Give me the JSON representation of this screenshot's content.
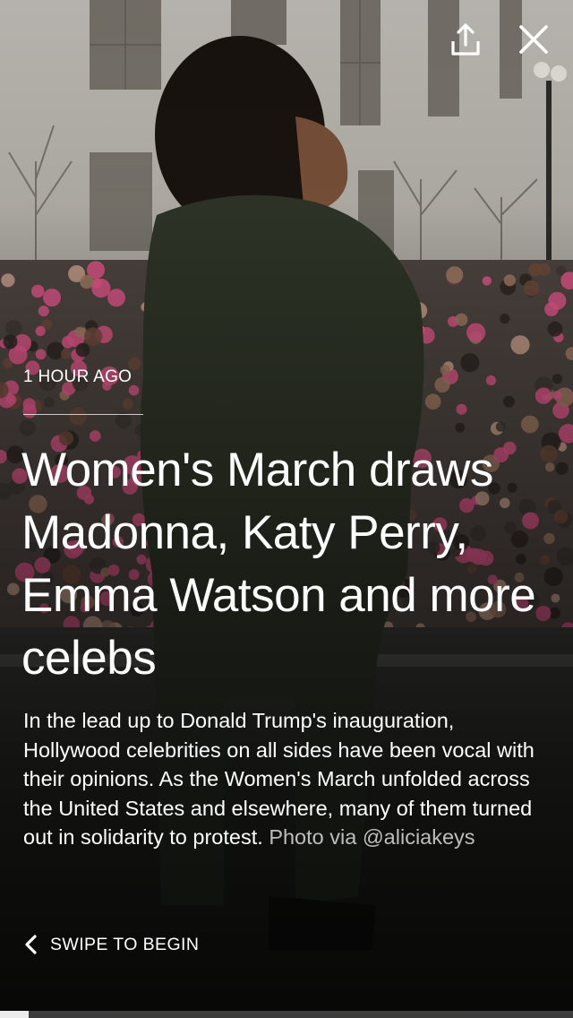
{
  "story": {
    "timestamp": "1 HOUR AGO",
    "headline": "Women's March draws Madonna, Katy Perry, Emma Watson and more celebs",
    "summary": "In the lead up to Donald Trump's inauguration, Hollywood celebrities on all sides have been vocal with their opinions. As the Women's March unfolded across the United States and elsewhere, many of them turned out in solidarity to protest.",
    "photo_credit": "Photo via @aliciakeys"
  },
  "navigation": {
    "swipe_label": "SWIPE TO BEGIN",
    "swipe_icon": "chevron-left-icon"
  },
  "toolbar": {
    "share_icon": "share-icon",
    "close_icon": "close-icon"
  },
  "progress": {
    "fraction": 0.05
  },
  "colors": {
    "text": "#ffffff",
    "overlay": "#000000",
    "pink_hats": "#e0558a"
  }
}
